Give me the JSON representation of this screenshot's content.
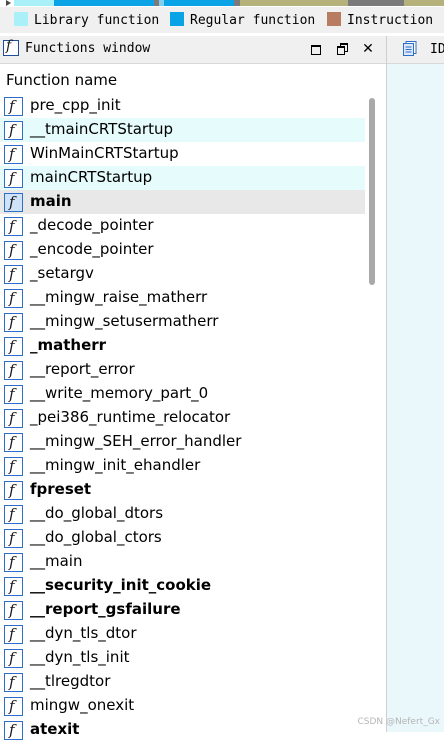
{
  "legend": {
    "items": [
      {
        "label": "Library function",
        "color": "#aaf0f8"
      },
      {
        "label": "Regular function",
        "color": "#0aa3e6"
      },
      {
        "label": "Instruction",
        "color": "#b87c62"
      }
    ]
  },
  "nav_band": {
    "colors": {
      "regular": "#0aa3e6",
      "library": "#aaf0f8",
      "data": "#b5b17a",
      "external": "#7a7a7a"
    }
  },
  "functions_window": {
    "title": "Functions window",
    "column_header": "Function name",
    "functions": [
      {
        "name": "pre_cpp_init",
        "bold": false,
        "state": ""
      },
      {
        "name": "__tmainCRTStartup",
        "bold": false,
        "state": "library"
      },
      {
        "name": "WinMainCRTStartup",
        "bold": false,
        "state": ""
      },
      {
        "name": "mainCRTStartup",
        "bold": false,
        "state": "library"
      },
      {
        "name": "main",
        "bold": true,
        "state": "selected"
      },
      {
        "name": "_decode_pointer",
        "bold": false,
        "state": ""
      },
      {
        "name": "_encode_pointer",
        "bold": false,
        "state": ""
      },
      {
        "name": "_setargv",
        "bold": false,
        "state": ""
      },
      {
        "name": "__mingw_raise_matherr",
        "bold": false,
        "state": ""
      },
      {
        "name": "__mingw_setusermatherr",
        "bold": false,
        "state": ""
      },
      {
        "name": "_matherr",
        "bold": true,
        "state": ""
      },
      {
        "name": "__report_error",
        "bold": false,
        "state": ""
      },
      {
        "name": "__write_memory_part_0",
        "bold": false,
        "state": ""
      },
      {
        "name": "_pei386_runtime_relocator",
        "bold": false,
        "state": ""
      },
      {
        "name": "__mingw_SEH_error_handler",
        "bold": false,
        "state": ""
      },
      {
        "name": "__mingw_init_ehandler",
        "bold": false,
        "state": ""
      },
      {
        "name": "fpreset",
        "bold": true,
        "state": ""
      },
      {
        "name": "__do_global_dtors",
        "bold": false,
        "state": ""
      },
      {
        "name": "__do_global_ctors",
        "bold": false,
        "state": ""
      },
      {
        "name": "__main",
        "bold": false,
        "state": ""
      },
      {
        "name": "__security_init_cookie",
        "bold": true,
        "state": ""
      },
      {
        "name": "__report_gsfailure",
        "bold": true,
        "state": ""
      },
      {
        "name": "__dyn_tls_dtor",
        "bold": false,
        "state": ""
      },
      {
        "name": "__dyn_tls_init",
        "bold": false,
        "state": ""
      },
      {
        "name": "__tlregdtor",
        "bold": false,
        "state": ""
      },
      {
        "name": "mingw_onexit",
        "bold": false,
        "state": ""
      },
      {
        "name": "atexit",
        "bold": true,
        "state": ""
      }
    ]
  },
  "right_pane": {
    "tab_label": "ID",
    "tab_icon": "ida-view-icon"
  },
  "watermark": "CSDN @Nefert_Gx"
}
